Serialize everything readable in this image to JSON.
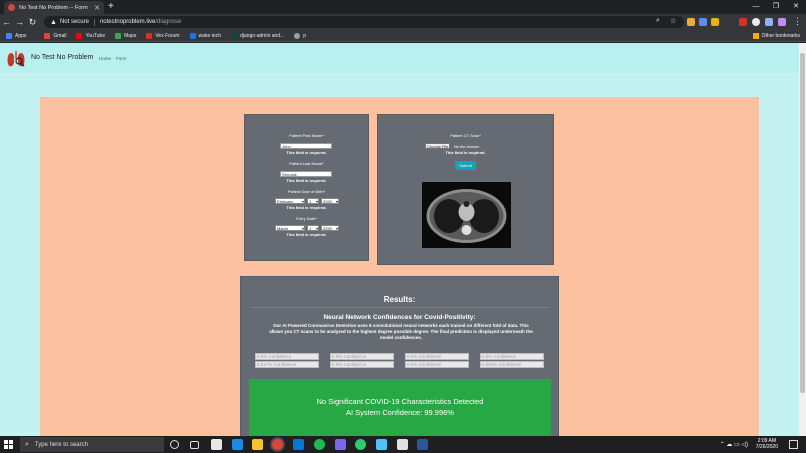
{
  "browser": {
    "tab_title": "No Test No Problem -- Form",
    "new_tab": "+",
    "url_warning": "Not secure",
    "url_host": "notestnoproblem.live",
    "url_path": "/diagnose",
    "window_controls": [
      "—",
      "❐",
      "✕"
    ],
    "bookmarks": [
      {
        "label": "Apps",
        "color": "#4285f4"
      },
      {
        "label": "Gmail",
        "color": "#ea4335"
      },
      {
        "label": "YouTube",
        "color": "#ff0000"
      },
      {
        "label": "Maps",
        "color": "#34a853"
      },
      {
        "label": "Vex Forum",
        "color": "#d93025"
      },
      {
        "label": "wake tech",
        "color": "#1a73e8"
      },
      {
        "label": "django-admin and...",
        "color": "#0c4b33"
      },
      {
        "label": "p",
        "color": "#9aa0a6"
      }
    ],
    "other_bookmarks": "Other bookmarks"
  },
  "site": {
    "brand": "No Test No Problem",
    "nav": [
      "Home",
      "Form"
    ]
  },
  "form": {
    "first_name_label": "Patient First Name*",
    "first_name_value": "John",
    "last_name_label": "Patient Last Name*",
    "last_name_value": "Renolds",
    "dob_label": "Patient Date of Birth*",
    "dob_month": "February",
    "dob_day": "1",
    "dob_year": "2020",
    "entry_label": "Entry Date*",
    "entry_month": "March",
    "entry_day": "1",
    "entry_year": "2020",
    "required_msg": "This field is required.",
    "ct_label": "Patient CT Scan*",
    "choose_file": "Choose File",
    "no_file": "No file chosen",
    "submit": "Submit"
  },
  "results": {
    "title": "Results:",
    "nn_title": "Neural Network Confidences for Covid-Positivity:",
    "description": "Our AI Powered Coronavirus Detection uses 8 convolutional neural networks each trained on different fold of data. This allows you CT scans to be analyzed to the highest degree possible degree. The final prediction is displayed underneath the model confidences.",
    "confidences": [
      "0.0% Confidence",
      "0.0% Confidence",
      "0.0% Confidence",
      "0.0% Confidence",
      "0.017% Confidence",
      "0.0% Confidence",
      "0.0% Confidence",
      "0.004% Confidence"
    ],
    "verdict_line1": "No Significant COVID-19 Characteristics Detected",
    "verdict_line2": "AI System Confidence: 99.996%"
  },
  "taskbar": {
    "search_placeholder": "Type here to search",
    "time": "2:09 AM",
    "date": "7/26/2020"
  },
  "colors": {
    "page_bg": "#c4f2f0",
    "card_area": "#fbc1a0",
    "panel": "#666b73",
    "verdict": "#28a745",
    "submit": "#17a2b8"
  }
}
